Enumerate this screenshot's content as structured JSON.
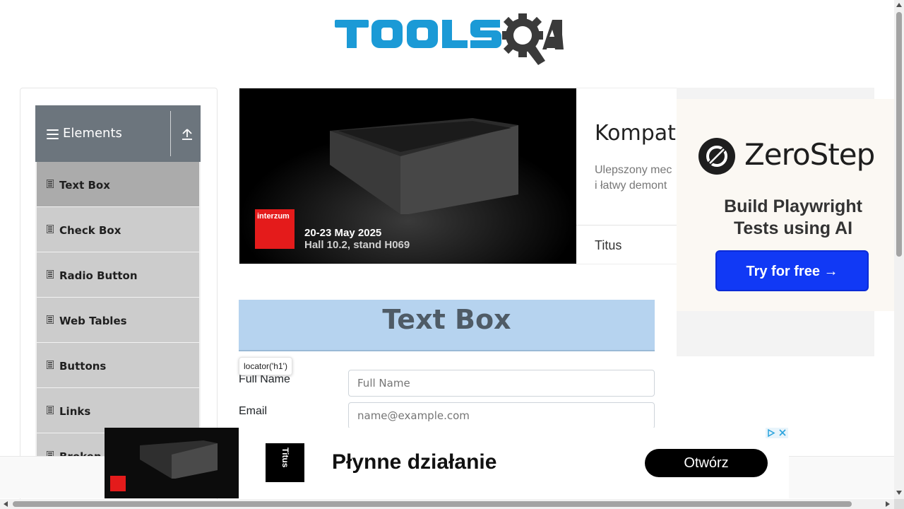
{
  "header": {
    "logo_text": "TOOLSQA",
    "brand_colors": {
      "primary": "#1b9ad6",
      "secondary": "#3a3a3a"
    }
  },
  "sidebar": {
    "group_title": "Elements",
    "items": [
      {
        "label": "Text Box",
        "active": true
      },
      {
        "label": "Check Box",
        "active": false
      },
      {
        "label": "Radio Button",
        "active": false
      },
      {
        "label": "Web Tables",
        "active": false
      },
      {
        "label": "Buttons",
        "active": false
      },
      {
        "label": "Links",
        "active": false
      },
      {
        "label": "Broken L",
        "active": false
      }
    ]
  },
  "top_ad": {
    "title": "Kompaty",
    "desc_line1": "Ulepszony mec",
    "desc_line2": "i łatwy demont",
    "brand": "Titus",
    "promo_brand": "interzum",
    "promo_date": "20-23 May 2025",
    "promo_hall": "Hall 10.2, stand H069"
  },
  "side_ad": {
    "brand": "ZeroStep",
    "tagline_line1": "Build Playwright",
    "tagline_line2": "Tests using AI",
    "cta": "Try for free →",
    "accent": "#1139f5"
  },
  "main": {
    "page_title": "Text Box",
    "tooltip": "locator('h1')",
    "fields": [
      {
        "label": "Full Name",
        "placeholder": "Full Name"
      },
      {
        "label": "Email",
        "placeholder": "name@example.com"
      }
    ]
  },
  "bottom_ad": {
    "logo_text": "Titus",
    "headline": "Płynne działanie",
    "cta": "Otwórz"
  }
}
